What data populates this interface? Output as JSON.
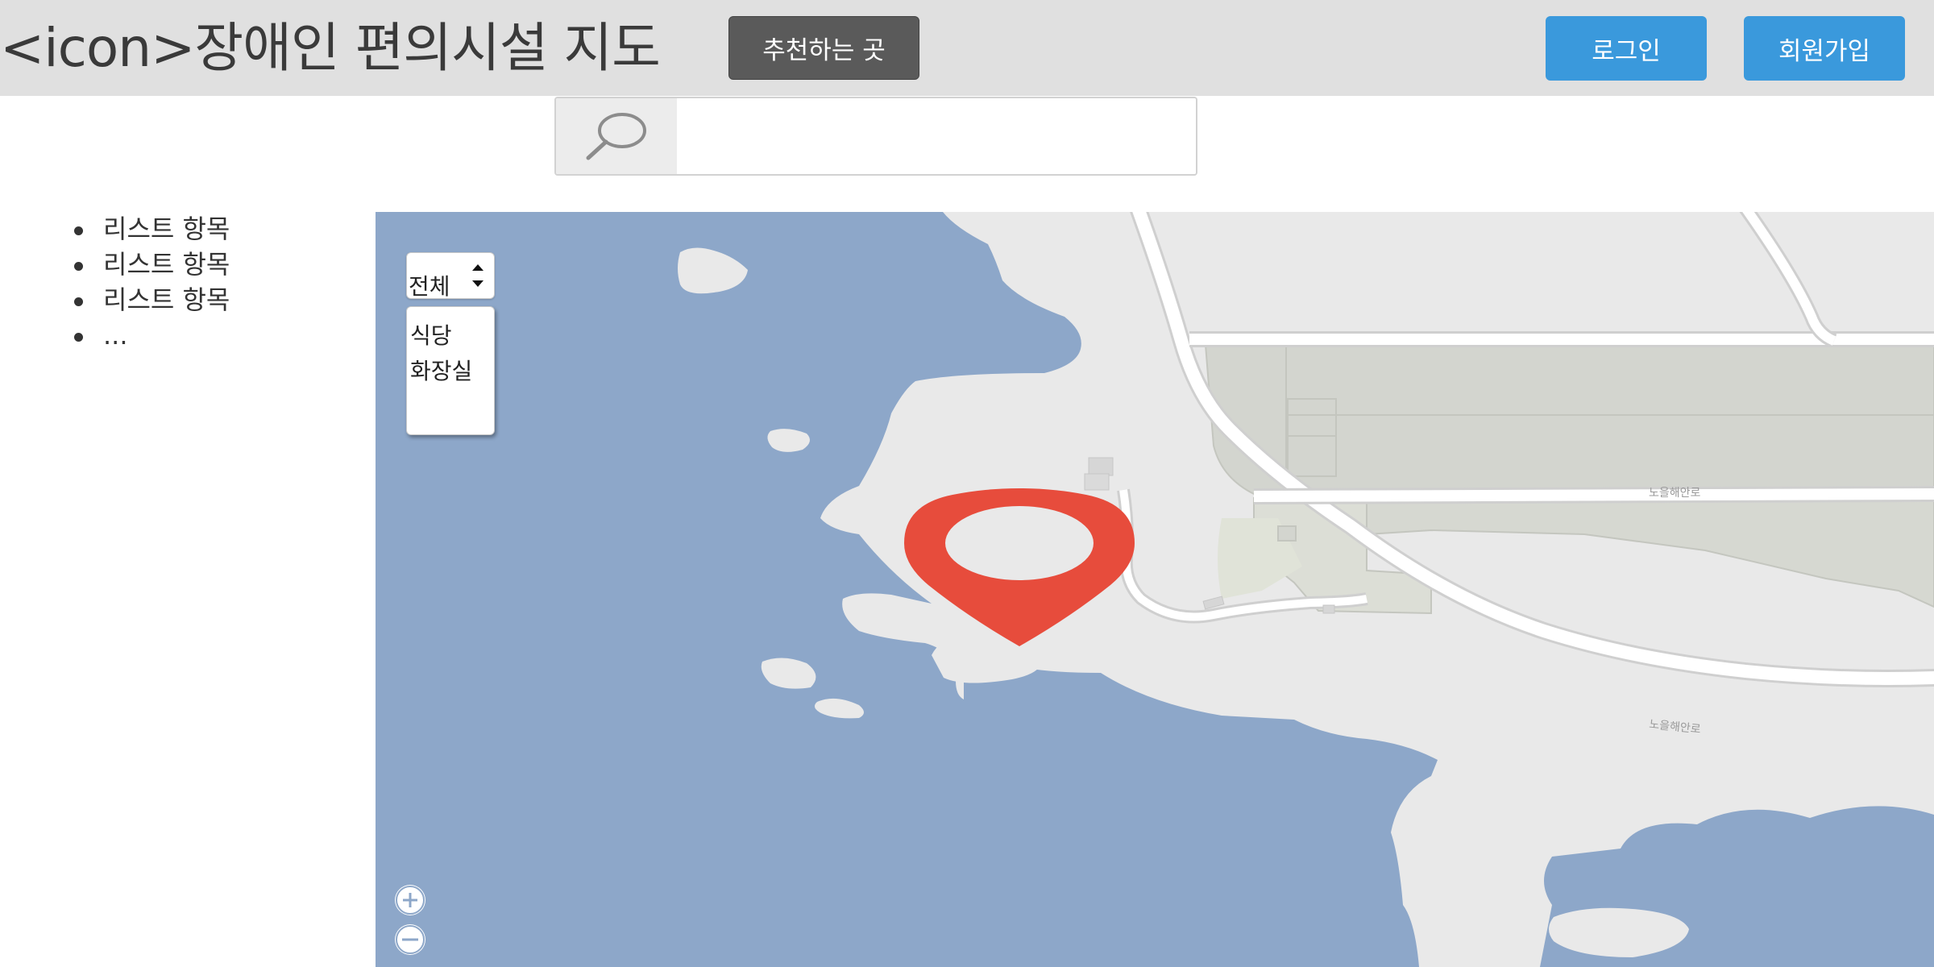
{
  "header": {
    "title": "<icon>장애인 편의시설 지도",
    "recommend_label": "추천하는 곳",
    "login_label": "로그인",
    "signup_label": "회원가입"
  },
  "search": {
    "icon": "search-icon",
    "value": "",
    "placeholder": ""
  },
  "list": {
    "items": [
      "리스트 항목",
      "리스트 항목",
      "리스트 항목",
      "..."
    ]
  },
  "map": {
    "category_select": {
      "selected": "전체",
      "options": [
        "식당",
        "화장실"
      ]
    },
    "zoom_in_icon": "plus-icon",
    "zoom_out_icon": "minus-icon",
    "marker_icon": "map-pin-icon",
    "road_label": "노을해안로"
  },
  "colors": {
    "header_bg": "#e0e0e0",
    "recommend_button": "#5a5a5a",
    "auth_buttons": "#3a99dc",
    "water": "#8da7c9",
    "land": "#e9e9e9",
    "marker": "#e74c3c"
  }
}
